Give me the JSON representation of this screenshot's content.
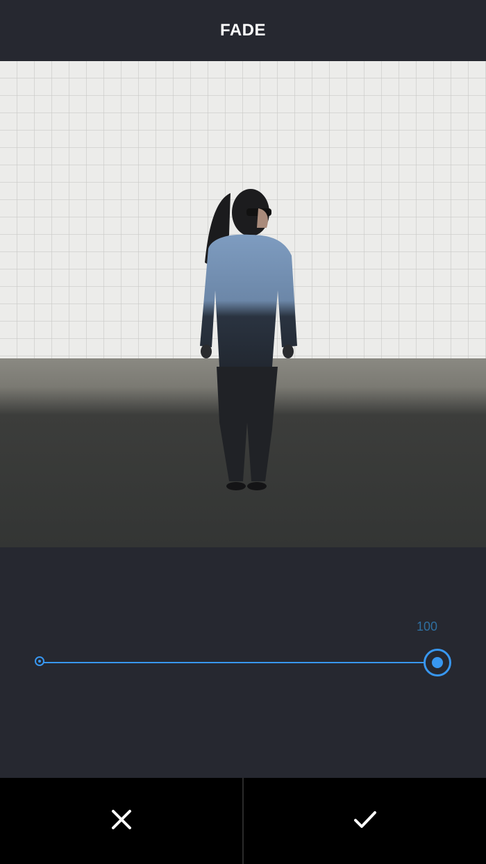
{
  "header": {
    "title": "FADE"
  },
  "adjustment": {
    "value_label": "100",
    "value": 100,
    "min": 0,
    "max": 100
  },
  "icons": {
    "cancel": "close-icon",
    "done": "checkmark-icon"
  },
  "colors": {
    "background": "#262830",
    "accent": "#3897f0",
    "footer": "#000000",
    "title": "#ffffff"
  }
}
